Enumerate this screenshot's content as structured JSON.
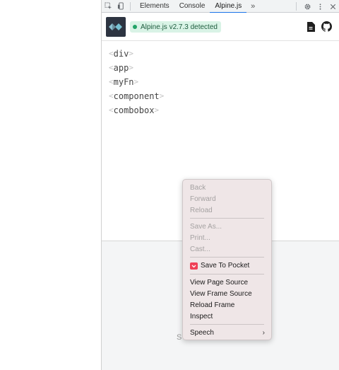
{
  "toolbar": {
    "tabs": [
      {
        "label": "Elements"
      },
      {
        "label": "Console"
      },
      {
        "label": "Alpine.js"
      }
    ],
    "more_label": "»",
    "active_color": "#1a73e8"
  },
  "header": {
    "detected_label": "Alpine.js v2.7.3 detected",
    "detected_bg": "#d9f3e6",
    "icons": [
      "document-icon",
      "github-icon"
    ]
  },
  "tree": {
    "items": [
      {
        "label": "div"
      },
      {
        "label": "app"
      },
      {
        "label": "myFn"
      },
      {
        "label": "component"
      },
      {
        "label": "combobox"
      }
    ]
  },
  "lower": {
    "text": "S"
  },
  "context_menu": {
    "back": "Back",
    "forward": "Forward",
    "reload": "Reload",
    "save_as": "Save As...",
    "print": "Print...",
    "cast": "Cast...",
    "save_to_pocket": "Save To Pocket",
    "view_page_source": "View Page Source",
    "view_frame_source": "View Frame Source",
    "reload_frame": "Reload Frame",
    "inspect": "Inspect",
    "speech": "Speech",
    "pocket_color": "#ef4056"
  }
}
